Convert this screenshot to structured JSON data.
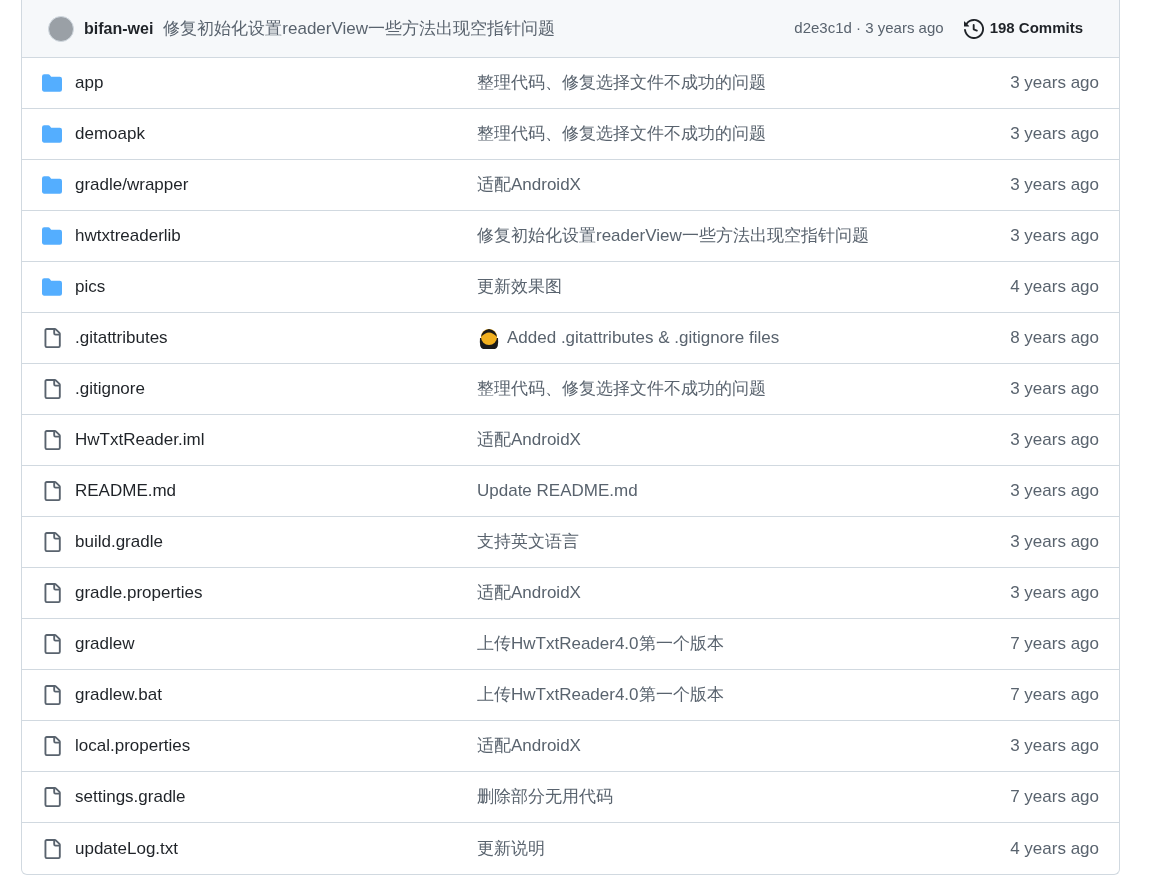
{
  "latest_commit": {
    "author": "bifan-wei",
    "message": "修复初始化设置readerView一些方法出现空指针问题",
    "sha_time": "d2e3c1d · 3 years ago",
    "commits": "198 Commits"
  },
  "files": [
    {
      "kind": "folder",
      "name": "app",
      "message": "整理代码、修复选择文件不成功的问题",
      "emoji": false,
      "time": "3 years ago"
    },
    {
      "kind": "folder",
      "name": "demoapk",
      "message": "整理代码、修复选择文件不成功的问题",
      "emoji": false,
      "time": "3 years ago"
    },
    {
      "kind": "folder",
      "name": "gradle/wrapper",
      "message": "适配AndroidX",
      "emoji": false,
      "time": "3 years ago"
    },
    {
      "kind": "folder",
      "name": "hwtxtreaderlib",
      "message": "修复初始化设置readerView一些方法出现空指针问题",
      "emoji": false,
      "time": "3 years ago"
    },
    {
      "kind": "folder",
      "name": "pics",
      "message": "更新效果图",
      "emoji": false,
      "time": "4 years ago"
    },
    {
      "kind": "file",
      "name": ".gitattributes",
      "message": "Added .gitattributes & .gitignore files",
      "emoji": true,
      "time": "8 years ago"
    },
    {
      "kind": "file",
      "name": ".gitignore",
      "message": "整理代码、修复选择文件不成功的问题",
      "emoji": false,
      "time": "3 years ago"
    },
    {
      "kind": "file",
      "name": "HwTxtReader.iml",
      "message": "适配AndroidX",
      "emoji": false,
      "time": "3 years ago"
    },
    {
      "kind": "file",
      "name": "README.md",
      "message": "Update README.md",
      "emoji": false,
      "time": "3 years ago"
    },
    {
      "kind": "file",
      "name": "build.gradle",
      "message": "支持英文语言",
      "emoji": false,
      "time": "3 years ago"
    },
    {
      "kind": "file",
      "name": "gradle.properties",
      "message": "适配AndroidX",
      "emoji": false,
      "time": "3 years ago"
    },
    {
      "kind": "file",
      "name": "gradlew",
      "message": "上传HwTxtReader4.0第一个版本",
      "emoji": false,
      "time": "7 years ago"
    },
    {
      "kind": "file",
      "name": "gradlew.bat",
      "message": "上传HwTxtReader4.0第一个版本",
      "emoji": false,
      "time": "7 years ago"
    },
    {
      "kind": "file",
      "name": "local.properties",
      "message": "适配AndroidX",
      "emoji": false,
      "time": "3 years ago"
    },
    {
      "kind": "file",
      "name": "settings.gradle",
      "message": "删除部分无用代码",
      "emoji": false,
      "time": "7 years ago"
    },
    {
      "kind": "file",
      "name": "updateLog.txt",
      "message": "更新说明",
      "emoji": false,
      "time": "4 years ago"
    }
  ]
}
